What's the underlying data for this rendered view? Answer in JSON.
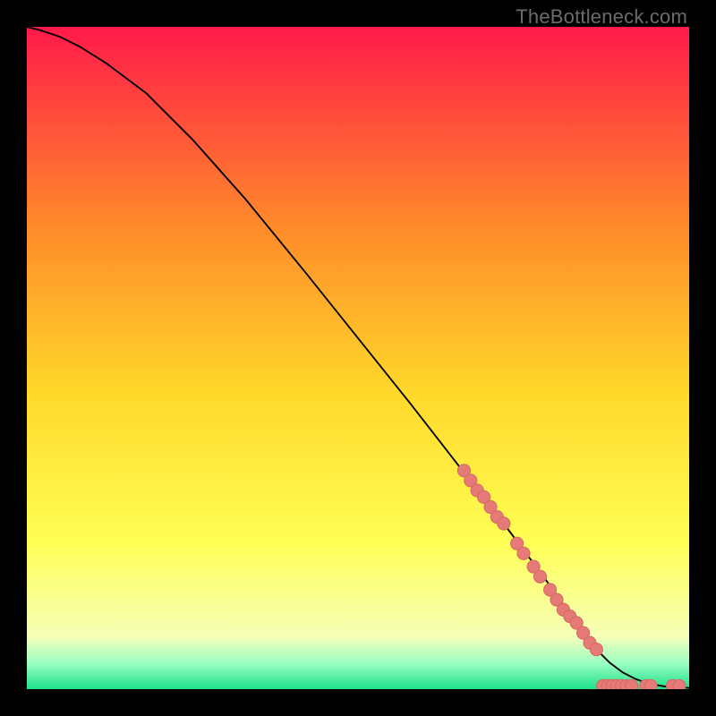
{
  "watermark": "TheBottleneck.com",
  "colors": {
    "frame": "#000000",
    "curve": "#000000",
    "point_fill": "#e67a76",
    "point_stroke": "#d86a66",
    "grad_top": "#ff1a4a",
    "grad_mid1": "#ff8a2a",
    "grad_mid2": "#ffd82a",
    "grad_mid3": "#ffff55",
    "grad_mid4": "#f6ffb8",
    "grad_mid5": "#9effc4",
    "grad_bot": "#1de08a"
  },
  "chart_data": {
    "type": "line",
    "title": "",
    "xlabel": "",
    "ylabel": "",
    "xlim": [
      0,
      100
    ],
    "ylim": [
      0,
      100
    ],
    "series": [
      {
        "name": "curve",
        "x": [
          0,
          2,
          5,
          8,
          12,
          18,
          25,
          33,
          42,
          50,
          58,
          65,
          72,
          78,
          83,
          86,
          88,
          90,
          92,
          94,
          97,
          100
        ],
        "y": [
          100,
          99.5,
          98.5,
          97,
          94.5,
          90,
          83,
          74,
          63,
          53,
          43,
          34,
          25,
          17,
          10,
          6,
          4,
          2.5,
          1.5,
          0.8,
          0.3,
          0.2
        ]
      }
    ],
    "scatter": [
      {
        "x": 66,
        "y": 33
      },
      {
        "x": 67,
        "y": 31.5
      },
      {
        "x": 68,
        "y": 30
      },
      {
        "x": 69,
        "y": 29
      },
      {
        "x": 70,
        "y": 27.5
      },
      {
        "x": 71,
        "y": 26
      },
      {
        "x": 72,
        "y": 25
      },
      {
        "x": 74,
        "y": 22
      },
      {
        "x": 75,
        "y": 20.5
      },
      {
        "x": 76.5,
        "y": 18.5
      },
      {
        "x": 77.5,
        "y": 17
      },
      {
        "x": 79,
        "y": 15
      },
      {
        "x": 80,
        "y": 13.5
      },
      {
        "x": 81,
        "y": 12
      },
      {
        "x": 82,
        "y": 11
      },
      {
        "x": 83,
        "y": 10
      },
      {
        "x": 84,
        "y": 8.5
      },
      {
        "x": 85,
        "y": 7
      },
      {
        "x": 86,
        "y": 6
      },
      {
        "x": 87,
        "y": 0.5
      },
      {
        "x": 87.7,
        "y": 0.5
      },
      {
        "x": 88.4,
        "y": 0.5
      },
      {
        "x": 89.1,
        "y": 0.5
      },
      {
        "x": 89.8,
        "y": 0.5
      },
      {
        "x": 90.5,
        "y": 0.5
      },
      {
        "x": 91.3,
        "y": 0.5
      },
      {
        "x": 93.5,
        "y": 0.5
      },
      {
        "x": 94.2,
        "y": 0.5
      },
      {
        "x": 97.5,
        "y": 0.5
      },
      {
        "x": 98.5,
        "y": 0.5
      }
    ]
  }
}
